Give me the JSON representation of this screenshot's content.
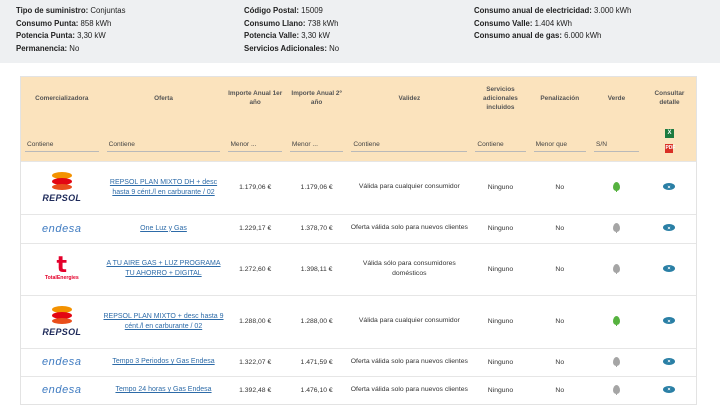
{
  "summary": {
    "col1": [
      {
        "label": "Tipo de suministro:",
        "value": " Conjuntas"
      },
      {
        "label": "Consumo Punta:",
        "value": " 858 kWh"
      },
      {
        "label": "Potencia Punta:",
        "value": " 3,30 kW"
      },
      {
        "label": "Permanencia:",
        "value": " No"
      }
    ],
    "col2": [
      {
        "label": "Código Postal:",
        "value": " 15009"
      },
      {
        "label": "Consumo Llano:",
        "value": " 738 kWh"
      },
      {
        "label": "Potencia Valle:",
        "value": " 3,30 kW"
      },
      {
        "label": "Servicios Adicionales:",
        "value": " No"
      }
    ],
    "col3": [
      {
        "label": "Consumo anual de electricidad:",
        "value": " 3.000 kWh"
      },
      {
        "label": "Consumo Valle:",
        "value": " 1.404 kWh"
      },
      {
        "label": "Consumo anual de gas:",
        "value": " 6.000 kWh"
      }
    ]
  },
  "table": {
    "headers": [
      "Comercializadora",
      "Oferta",
      "Importe Anual 1er año",
      "Importe Anual 2º año",
      "Validez",
      "Servicios adicionales incluidos",
      "Penalización",
      "Verde",
      "Consultar detalle"
    ],
    "filters": [
      "Contiene",
      "Contiene",
      "Menor ...",
      "Menor ...",
      "Contiene",
      "Contiene",
      "Menor que",
      "S/N"
    ],
    "export_xls": "X",
    "export_pdf": "PDF",
    "rows": [
      {
        "brand": "REPSOL",
        "offer": "REPSOL PLAN MIXTO DH + desc hasta 9 cént./l en carburante / 02",
        "y1": "1.179,06 €",
        "y2": "1.179,06 €",
        "validity": "Válida para cualquier consumidor",
        "services": "Ninguno",
        "penalty": "No",
        "green": "green"
      },
      {
        "brand": "endesa",
        "offer": "One Luz y Gas",
        "y1": "1.229,17 €",
        "y2": "1.378,70 €",
        "validity": "Oferta válida solo para nuevos clientes",
        "services": "Ninguno",
        "penalty": "No",
        "green": "grey"
      },
      {
        "brand": "TotalEnergies",
        "offer": "A TU AIRE GAS + LUZ PROGRAMA TU AHORRO + DIGITAL",
        "y1": "1.272,60 €",
        "y2": "1.398,11 €",
        "validity": "Válida sólo para consumidores domésticos",
        "services": "Ninguno",
        "penalty": "No",
        "green": "grey"
      },
      {
        "brand": "REPSOL",
        "offer": "REPSOL PLAN MIXTO + desc hasta 9 cént./l en carburante / 02",
        "y1": "1.288,00 €",
        "y2": "1.288,00 €",
        "validity": "Válida para cualquier consumidor",
        "services": "Ninguno",
        "penalty": "No",
        "green": "green"
      },
      {
        "brand": "endesa",
        "offer": "Tempo 3 Periodos y Gas Endesa",
        "y1": "1.322,07 €",
        "y2": "1.471,59 €",
        "validity": "Oferta válida solo para nuevos clientes",
        "services": "Ninguno",
        "penalty": "No",
        "green": "grey"
      },
      {
        "brand": "endesa",
        "offer": "Tempo 24 horas y Gas Endesa",
        "y1": "1.392,48 €",
        "y2": "1.476,10 €",
        "validity": "Oferta válida solo para nuevos clientes",
        "services": "Ninguno",
        "penalty": "No",
        "green": "grey"
      }
    ]
  },
  "colors": {
    "header_bg": "#fbe3bd",
    "link": "#2d6ba8",
    "eye": "#2a7fa5",
    "green_leaf": "#56b23f",
    "grey_leaf": "#a5a5a5"
  }
}
